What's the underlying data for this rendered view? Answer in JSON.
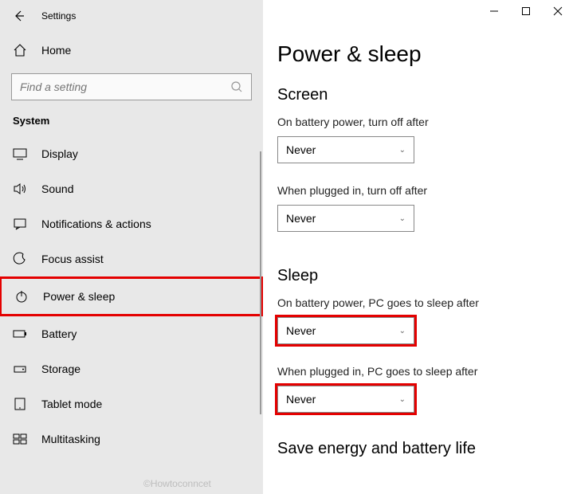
{
  "app": {
    "title": "Settings"
  },
  "home": {
    "label": "Home"
  },
  "search": {
    "placeholder": "Find a setting"
  },
  "section": {
    "label": "System"
  },
  "nav": {
    "items": [
      {
        "label": "Display"
      },
      {
        "label": "Sound"
      },
      {
        "label": "Notifications & actions"
      },
      {
        "label": "Focus assist"
      },
      {
        "label": "Power & sleep"
      },
      {
        "label": "Battery"
      },
      {
        "label": "Storage"
      },
      {
        "label": "Tablet mode"
      },
      {
        "label": "Multitasking"
      }
    ]
  },
  "page": {
    "title": "Power & sleep",
    "screen_heading": "Screen",
    "screen_battery_label": "On battery power, turn off after",
    "screen_battery_value": "Never",
    "screen_plugged_label": "When plugged in, turn off after",
    "screen_plugged_value": "Never",
    "sleep_heading": "Sleep",
    "sleep_battery_label": "On battery power, PC goes to sleep after",
    "sleep_battery_value": "Never",
    "sleep_plugged_label": "When plugged in, PC goes to sleep after",
    "sleep_plugged_value": "Never",
    "energy_heading": "Save energy and battery life"
  },
  "watermark": "©Howtoconncet"
}
